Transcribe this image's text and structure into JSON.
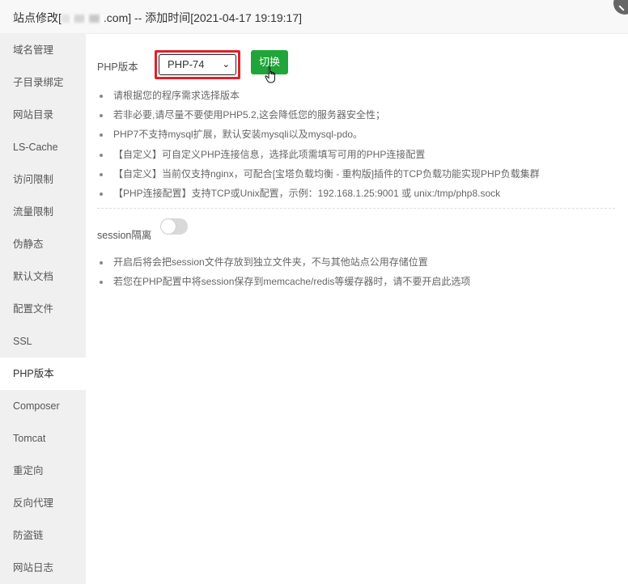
{
  "window": {
    "title_prefix": "站点修改[",
    "title_domain_suffix": ".com] -- 添加时间[2021-04-17 19:19:17]",
    "close_icon": "close-icon"
  },
  "sidebar": {
    "items": [
      {
        "label": "域名管理",
        "active": false
      },
      {
        "label": "子目录绑定",
        "active": false
      },
      {
        "label": "网站目录",
        "active": false
      },
      {
        "label": "LS-Cache",
        "active": false
      },
      {
        "label": "访问限制",
        "active": false
      },
      {
        "label": "流量限制",
        "active": false
      },
      {
        "label": "伪静态",
        "active": false
      },
      {
        "label": "默认文档",
        "active": false
      },
      {
        "label": "配置文件",
        "active": false
      },
      {
        "label": "SSL",
        "active": false
      },
      {
        "label": "PHP版本",
        "active": true
      },
      {
        "label": "Composer",
        "active": false
      },
      {
        "label": "Tomcat",
        "active": false
      },
      {
        "label": "重定向",
        "active": false
      },
      {
        "label": "反向代理",
        "active": false
      },
      {
        "label": "防盗链",
        "active": false
      },
      {
        "label": "网站日志",
        "active": false
      }
    ]
  },
  "php": {
    "label": "PHP版本",
    "selected_version": "PHP-74",
    "switch_button": "切换",
    "highlight_color": "#e0202a",
    "button_color": "#20a53a",
    "tips": [
      "请根据您的程序需求选择版本",
      "若非必要,请尽量不要使用PHP5.2,这会降低您的服务器安全性；",
      "PHP7不支持mysql扩展，默认安装mysqli以及mysql-pdo。",
      "【自定义】可自定义PHP连接信息，选择此项需填写可用的PHP连接配置",
      "【自定义】当前仅支持nginx，可配合[宝塔负载均衡 - 重构版]插件的TCP负载功能实现PHP负载集群",
      "【PHP连接配置】支持TCP或Unix配置，示例：192.168.1.25:9001 或 unix:/tmp/php8.sock"
    ]
  },
  "session": {
    "label": "session隔离",
    "enabled": false,
    "tips": [
      "开启后将会把session文件存放到独立文件夹，不与其他站点公用存储位置",
      "若您在PHP配置中将session保存到memcache/redis等缓存器时，请不要开启此选项"
    ]
  }
}
